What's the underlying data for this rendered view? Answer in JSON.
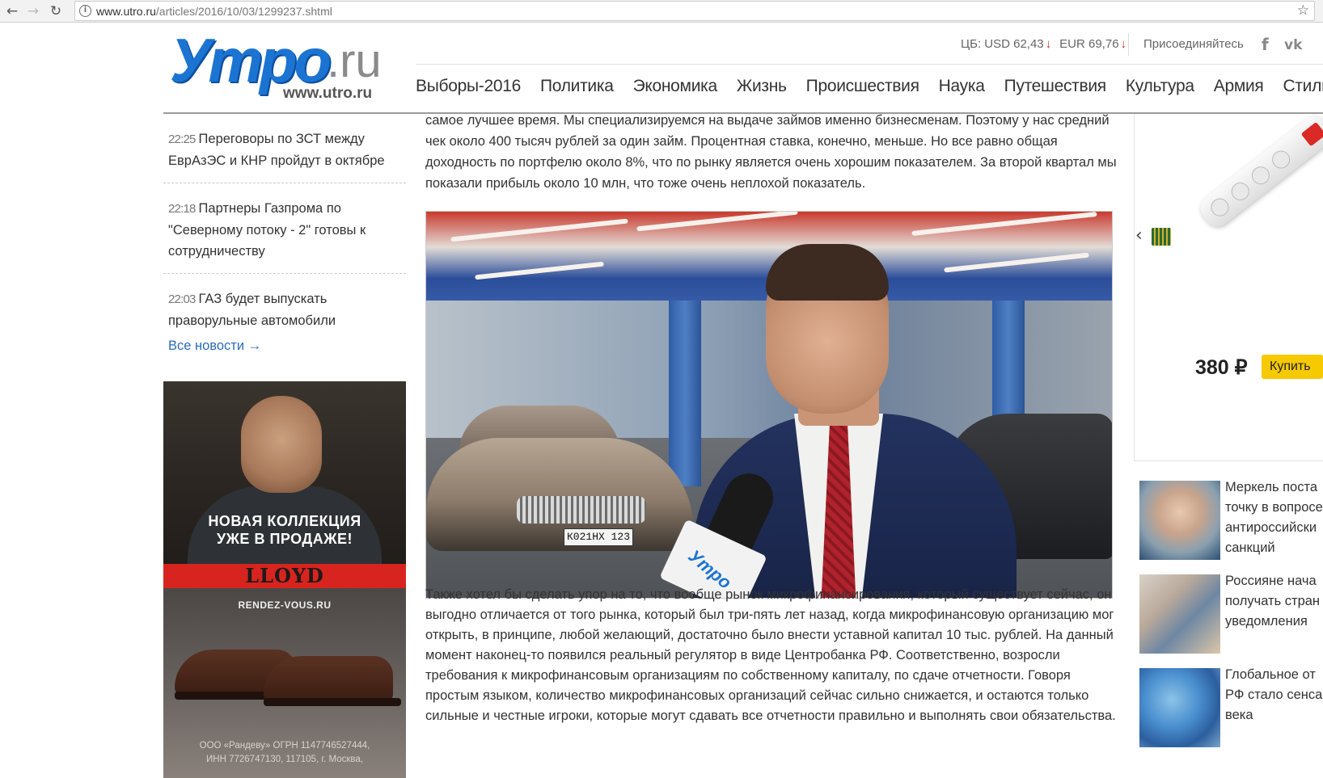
{
  "browser": {
    "url_host": "www.utro.ru",
    "url_path": "/articles/2016/10/03/1299237.shtml"
  },
  "header": {
    "logo_mark": "Утро",
    "logo_tld": ".ru",
    "logo_sub": "www.utro.ru",
    "rates": {
      "usd": "ЦБ: USD 62,43",
      "eur": "EUR 69,76",
      "arrow": "↓"
    },
    "join_label": "Присоединяйтесь",
    "socials": [
      {
        "icon": "facebook-icon",
        "glyph": "f"
      },
      {
        "icon": "vk-icon",
        "glyph": "vk"
      }
    ],
    "nav": [
      "Выборы-2016",
      "Политика",
      "Экономика",
      "Жизнь",
      "Происшествия",
      "Наука",
      "Путешествия",
      "Культура",
      "Армия",
      "Стиль"
    ]
  },
  "news": {
    "items": [
      {
        "time": "22:25",
        "title": "Переговоры по ЗСТ между ЕврАзЭС и КНР пройдут в октябре"
      },
      {
        "time": "22:18",
        "title": "Партнеры Газпрома по \"Северному потоку - 2\" готовы к сотрудничеству"
      },
      {
        "time": "22:03",
        "title": "ГАЗ будет выпускать праворульные автомобили"
      }
    ],
    "all_label": "Все новости →"
  },
  "ad_left": {
    "headline": "НОВАЯ КОЛЛЕКЦИЯ УЖЕ В ПРОДАЖЕ!",
    "brand": "LLOYD",
    "site": "RENDEZ-VOUS.RU",
    "legal": "ООО «Рандеву» ОГРН 1147746527444, ИНН 7726747130, 117105, г. Москва,"
  },
  "article": {
    "para1": "самое лучшее время. Мы специализируемся на выдаче займов именно бизнесменам. Поэтому у нас средний чек около 400 тысяч рублей за один займ. Процентная ставка, конечно, меньше. Но все равно общая доходность по портфелю около 8%, что по рынку является очень хорошим показателем. За второй квартал мы показали прибыль около 10 млн, что тоже очень неплохой показатель.",
    "photo_plate": "К021НХ 123",
    "photo_mic_logo": "Утро",
    "para2": "Также хотел бы сделать упор на то, что вообще рынок микрофинансирования, который существует сейчас, он выгодно отличается от того рынка, который был три-пять лет назад, когда микрофинансовую организацию мог открыть, в принципе, любой желающий, достаточно было внести уставной капитал 10 тыс. рублей. На данный момент наконец-то появился реальный регулятор в виде Центробанка РФ. Соответственно, возросли требования к микрофинансовым организациям по собственному капиталу, по сдаче отчетности. Говоря простым языком, количество микрофинансовых организаций сейчас сильно снижается, и остаются только сильные и честные игроки, которые могут сдавать все отчетности правильно и выполнять свои обязательства."
  },
  "right": {
    "price": "380 ₽",
    "buy_label": "Купить",
    "side_news": [
      {
        "lines": [
          "Меркель поста",
          "точку в вопросе",
          "антироссийски",
          "санкций"
        ]
      },
      {
        "lines": [
          "Россияне нача",
          "получать стран",
          "уведомления"
        ]
      },
      {
        "lines": [
          "Глобальное от",
          "РФ стало сенса",
          "века"
        ]
      }
    ]
  }
}
